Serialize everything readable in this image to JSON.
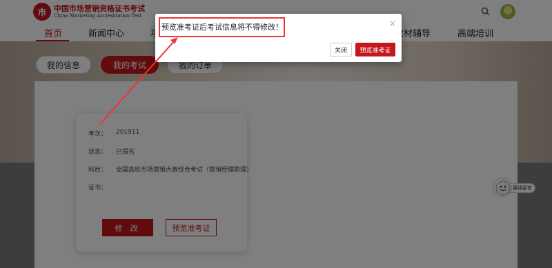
{
  "header": {
    "logo_mark": "市",
    "logo_cn": "中国市场营销资格证书考试",
    "logo_en": "China Marketing Accreditation Test"
  },
  "nav": {
    "items": [
      {
        "label": "首页",
        "active": true
      },
      {
        "label": "新闻中心",
        "active": false
      },
      {
        "label": "项",
        "active": false
      },
      {
        "label": "教材辅导",
        "active": false
      },
      {
        "label": "高端培训",
        "active": false
      }
    ]
  },
  "tabs": [
    {
      "label": "我的信息",
      "active": false
    },
    {
      "label": "我的考试",
      "active": true
    },
    {
      "label": "我的订单",
      "active": false
    }
  ],
  "exam_card": {
    "rows": [
      {
        "label": "考次：",
        "value": "201911"
      },
      {
        "label": "状态：",
        "value": "已报名"
      },
      {
        "label": "科目：",
        "value": "全国高校市场营销大赛综合考试（营销经理助理）"
      },
      {
        "label": "证书：",
        "value": ""
      }
    ],
    "edit_label": "修 改",
    "preview_label": "预览准考证"
  },
  "float_widget": {
    "label": "离线留言"
  },
  "modal": {
    "message": "预览准考证后考试信息将不得修改！",
    "close_symbol": "×",
    "cancel_label": "关闭",
    "confirm_label": "预览准考证"
  },
  "colors": {
    "brand_red": "#c4161c",
    "annotation_red": "#e33"
  }
}
